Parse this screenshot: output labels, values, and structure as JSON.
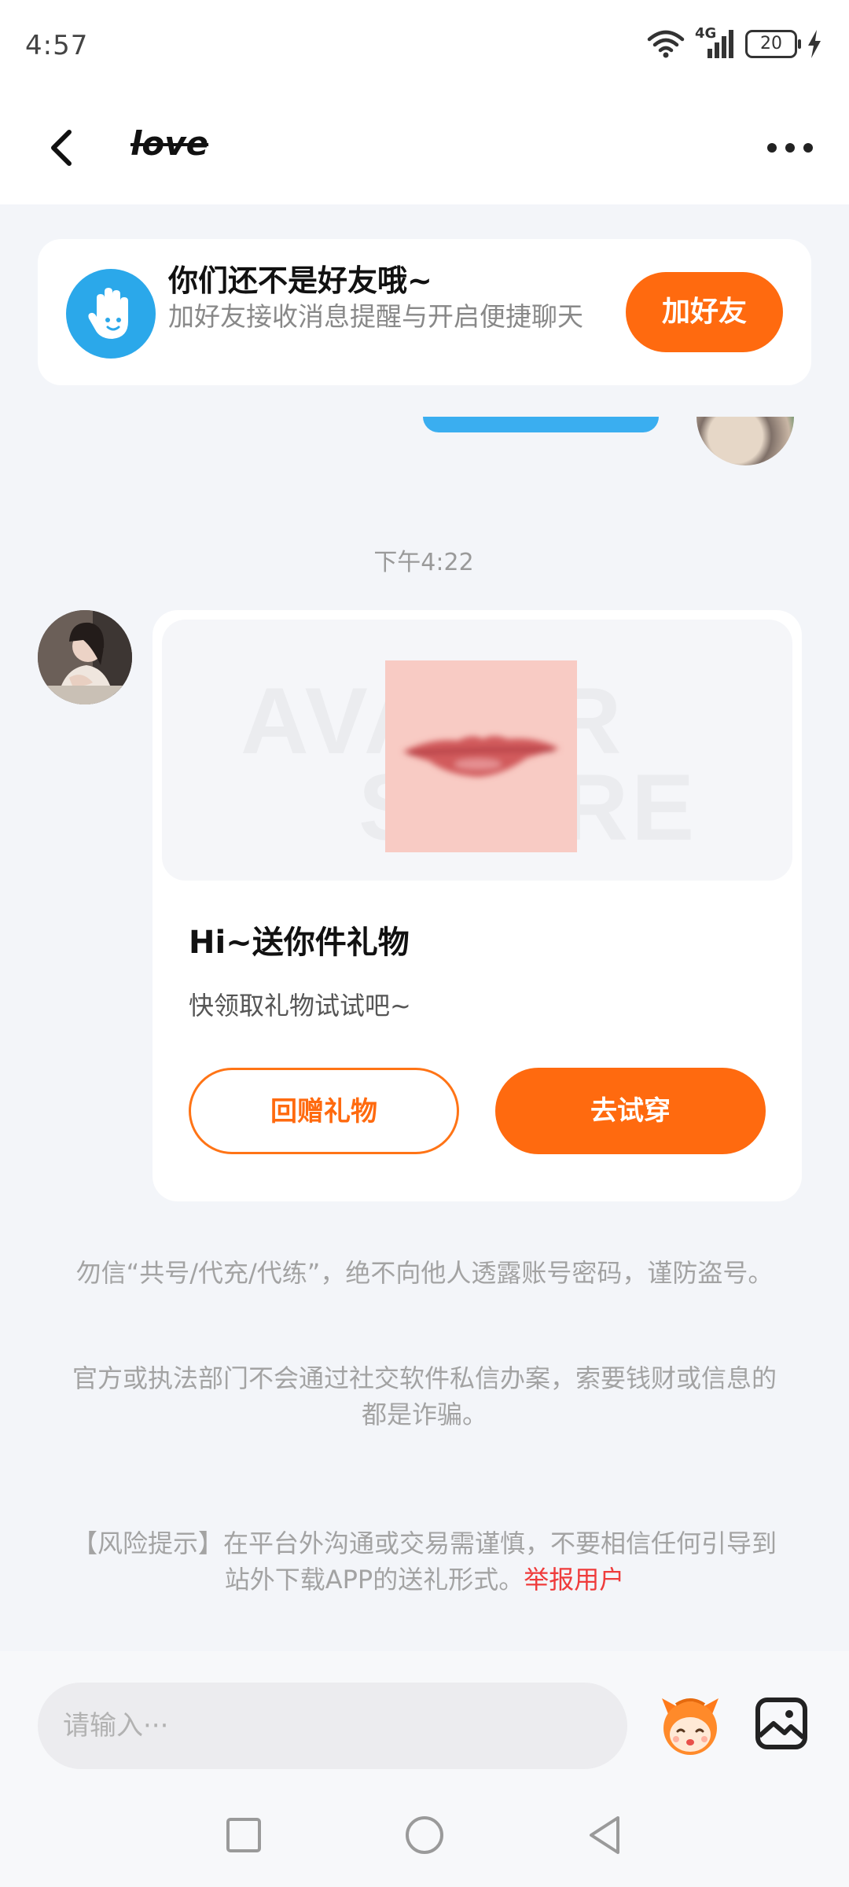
{
  "status_bar": {
    "time": "4:57",
    "network": "4G",
    "battery": "20"
  },
  "header": {
    "title": "love"
  },
  "friend_banner": {
    "title": "你们还不是好友哦~",
    "description": "加好友接收消息提醒与开启便捷聊天",
    "add_button": "加好友"
  },
  "chat": {
    "timestamp": "下午4:22",
    "gift_card": {
      "watermark_line1": "AVATAR",
      "watermark_line2": "STORE",
      "title": "Hi~送你件礼物",
      "subtitle": "快领取礼物试试吧~",
      "return_button": "回赠礼物",
      "try_button": "去试穿"
    }
  },
  "notices": {
    "notice_1": "勿信“共号/代充/代练”，绝不向他人透露账号密码，谨防盗号。",
    "notice_2": "官方或执法部门不会通过社交软件私信办案，索要钱财或信息的都是诈骗。",
    "notice_3": "【风险提示】在平台外沟通或交易需谨慎，不要相信任何引导到站外下载APP的送礼形式。",
    "report_link": "举报用户"
  },
  "input_bar": {
    "placeholder": "请输入···"
  },
  "colors": {
    "accent": "#ff6a0f",
    "banner_avatar": "#2ba8ea",
    "report": "#ef3b3b"
  }
}
